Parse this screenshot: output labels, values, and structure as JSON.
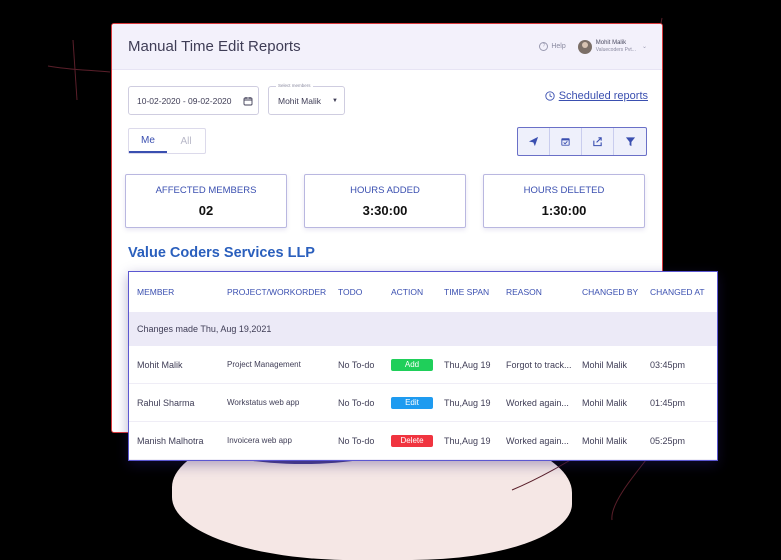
{
  "header": {
    "title": "Manual Time Edit Reports",
    "help_label": "Help",
    "user_name": "Mohit Malik",
    "user_org": "Valuecoders Pvt..."
  },
  "filters": {
    "date_range": "10-02-2020 - 09-02-2020",
    "member_label": "Select members",
    "member_value": "Mohit Malik",
    "scheduled_reports": "Scheduled reports"
  },
  "view_toggle": {
    "me": "Me",
    "all": "All"
  },
  "toolbar_icons": [
    "send-icon",
    "calendar-icon",
    "share-icon",
    "filter-icon"
  ],
  "stats": [
    {
      "label": "AFFECTED MEMBERS",
      "value": "02"
    },
    {
      "label": "HOURS ADDED",
      "value": "3:30:00"
    },
    {
      "label": "HOURS DELETED",
      "value": "1:30:00"
    }
  ],
  "company": "Value Coders Services LLP",
  "table": {
    "columns": [
      "MEMBER",
      "PROJECT/WORKORDER",
      "TODO",
      "ACTION",
      "TIME SPAN",
      "REASON",
      "CHANGED BY",
      "CHANGED AT"
    ],
    "group_label": "Changes made Thu, Aug 19,2021",
    "rows": [
      {
        "member": "Mohit Malik",
        "project": "Project Management",
        "todo": "No To-do",
        "action": "Add",
        "action_color": "#1fcf5a",
        "time_span": "Thu,Aug 19",
        "reason": "Forgot to track...",
        "changed_by": "Mohil Malik",
        "changed_at": "03:45pm"
      },
      {
        "member": "Rahul Sharma",
        "project": "Workstatus web app",
        "todo": "No To-do",
        "action": "Edit",
        "action_color": "#1e9bf0",
        "time_span": "Thu,Aug 19",
        "reason": "Worked again...",
        "changed_by": "Mohil Malik",
        "changed_at": "01:45pm"
      },
      {
        "member": "Manish Malhotra",
        "project": "Invoicera web app",
        "todo": "No To-do",
        "action": "Delete",
        "action_color": "#f0343f",
        "time_span": "Thu,Aug 19",
        "reason": "Worked again...",
        "changed_by": "Mohil Malik",
        "changed_at": "05:25pm"
      }
    ]
  },
  "colors": {
    "accent": "#3a4fb0",
    "table_border": "#5b57d1",
    "window_border": "#d9393c"
  }
}
